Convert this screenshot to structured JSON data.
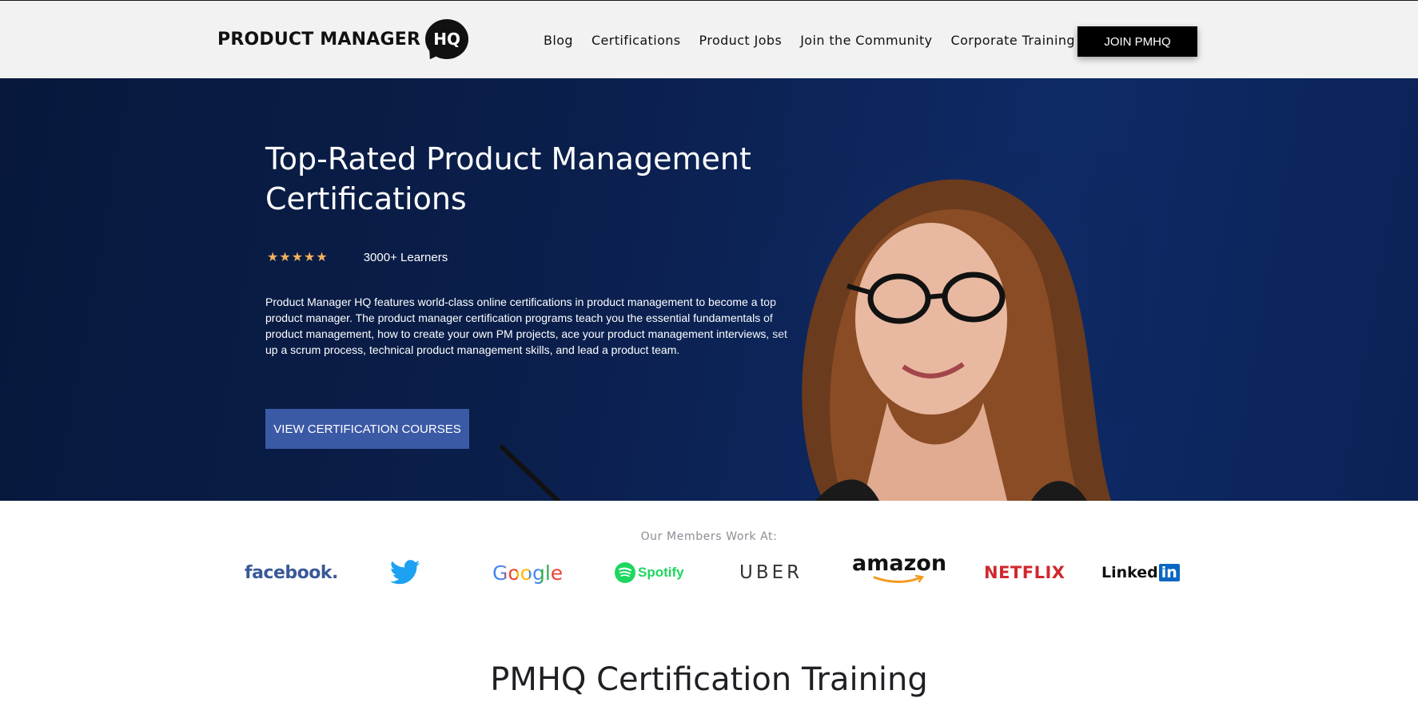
{
  "header": {
    "logo_text": "PRODUCT MANAGER",
    "logo_badge": "HQ",
    "nav": [
      "Blog",
      "Certifications",
      "Product Jobs",
      "Join the Community",
      "Corporate Training"
    ],
    "join_button": "JOIN PMHQ"
  },
  "hero": {
    "title": "Top-Rated Product Management Certifications",
    "stars": "★★★★★",
    "rating_value": 5,
    "learners": "3000+ Learners",
    "description": "Product Manager HQ features world-class online certifications in product management to become a top product manager. The product manager certification programs teach you the essential fundamentals of product management, how to create your own PM projects, ace your product management interviews, set up a scrum process, technical product management skills, and lead a product team.",
    "cta": "VIEW CERTIFICATION COURSES"
  },
  "members": {
    "label": "Our Members Work At:",
    "logos": {
      "facebook": "facebook.",
      "twitter": "twitter-bird-icon",
      "google": "Google",
      "spotify": "Spotify",
      "uber": "UBER",
      "amazon": "amazon",
      "netflix": "NETFLIX",
      "linkedin_a": "Linked",
      "linkedin_b": "in"
    }
  },
  "section": {
    "title": "PMHQ Certification Training"
  },
  "colors": {
    "hero_bg": "#0b1f4c",
    "cta_bg": "#3b5aa6",
    "star": "#f3b15b",
    "join_bg": "#000000"
  }
}
